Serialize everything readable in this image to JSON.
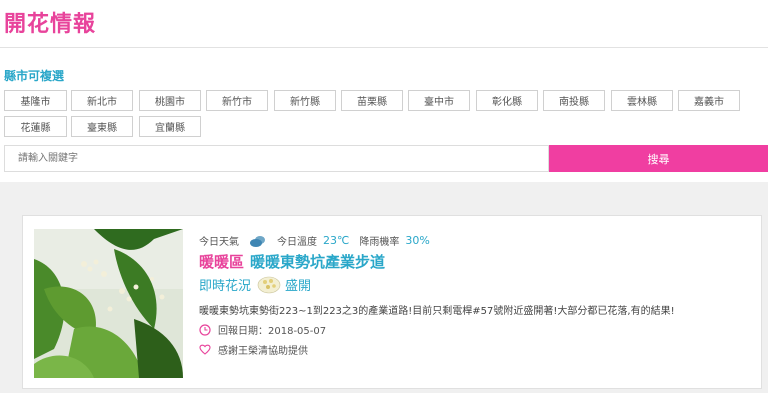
{
  "header": {
    "title": "開花情報"
  },
  "filter": {
    "label": "縣市可複選",
    "counties": [
      "基隆市",
      "新北市",
      "桃園市",
      "新竹市",
      "新竹縣",
      "苗栗縣",
      "臺中市",
      "彰化縣",
      "南投縣",
      "雲林縣",
      "嘉義市",
      "花蓮縣",
      "臺東縣",
      "宜蘭縣"
    ]
  },
  "search": {
    "placeholder": "請輸入關鍵字",
    "button_label": "搜尋"
  },
  "card": {
    "weather_label": "今日天氣",
    "weather_icon": "cloudy-icon",
    "temp_label": "今日溫度",
    "temp_value": "23℃",
    "rain_label": "降雨機率",
    "rain_value": "30%",
    "district": "暖暖區",
    "place_name": "暖暖東勢坑產業步道",
    "status_label": "即時花況",
    "status_value": "盛開",
    "description": "暖暖東勢坑東勢街223~1到223之3的產業道路!目前只剩電桿#57號附近盛開著!大部分都已花落,有的結果!",
    "date_text": "回報日期：2018-05-07",
    "thanks_text": "感謝王榮清協助提供",
    "colors": {
      "pink": "#e8439b",
      "blue": "#2aa7c9"
    }
  }
}
